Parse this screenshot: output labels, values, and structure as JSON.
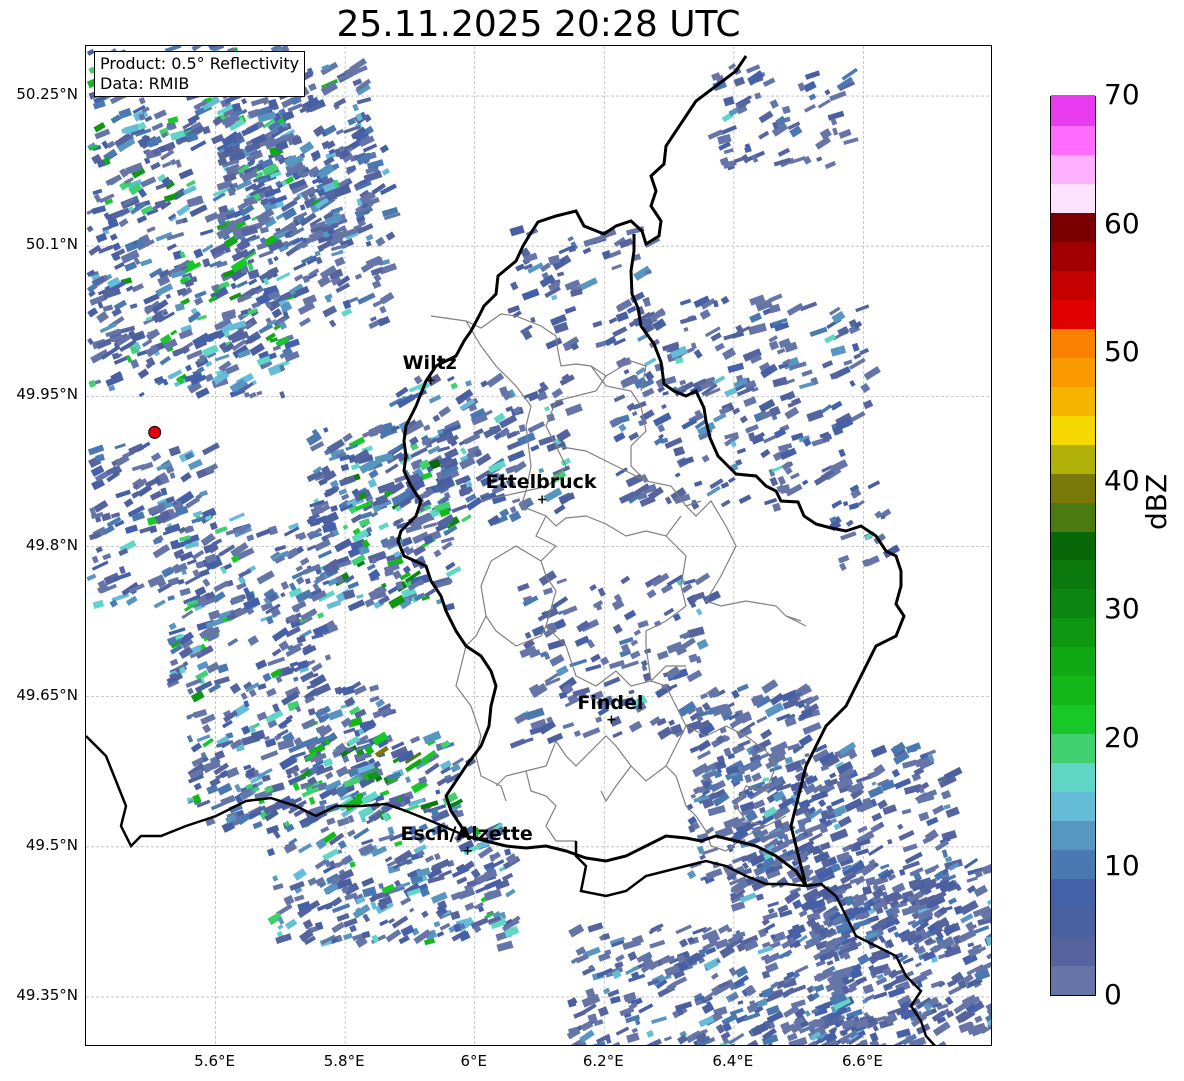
{
  "title": "25.11.2025 20:28 UTC",
  "info": {
    "product": "Product: 0.5° Reflectivity",
    "source": "Data: RMIB"
  },
  "lat_ticks": [
    "50.25°N",
    "50.1°N",
    "49.95°N",
    "49.8°N",
    "49.65°N",
    "49.5°N",
    "49.35°N"
  ],
  "lon_ticks": [
    "5.6°E",
    "5.8°E",
    "6°E",
    "6.2°E",
    "6.4°E",
    "6.6°E"
  ],
  "cities": [
    {
      "name": "Wiltz",
      "lat": 49.966,
      "lon": 5.932
    },
    {
      "name": "Ettelbruck",
      "lat": 49.847,
      "lon": 6.104
    },
    {
      "name": "Findel",
      "lat": 49.627,
      "lon": 6.211
    },
    {
      "name": "Esch/Alzette",
      "lat": 49.496,
      "lon": 5.989
    }
  ],
  "radar_site": {
    "lat": 49.914,
    "lon": 5.506,
    "color": "#e8000b"
  },
  "colorbar": {
    "unit": "dBZ",
    "min": 0,
    "max": 70,
    "tick_labels": [
      "0",
      "10",
      "20",
      "30",
      "40",
      "50",
      "60",
      "70"
    ],
    "colors": [
      "#6675a8",
      "#55649e",
      "#4a5fa0",
      "#4460a8",
      "#4a78b0",
      "#5896c2",
      "#65bcd8",
      "#5fd6c6",
      "#40d070",
      "#18c828",
      "#12b818",
      "#10a814",
      "#0e9812",
      "#0c8610",
      "#0a7a0e",
      "#086808",
      "#4a7a10",
      "#7a7808",
      "#b0b008",
      "#f5d800",
      "#f5b400",
      "#fa9a00",
      "#fb8000",
      "#e10000",
      "#c40000",
      "#a00000",
      "#7a0000",
      "#ffe2ff",
      "#ffb0ff",
      "#ff6cff",
      "#e83aee"
    ]
  },
  "map_extent": {
    "lon_min": 5.4,
    "lon_max": 6.8,
    "lat_min": 49.3,
    "lat_max": 50.3
  }
}
